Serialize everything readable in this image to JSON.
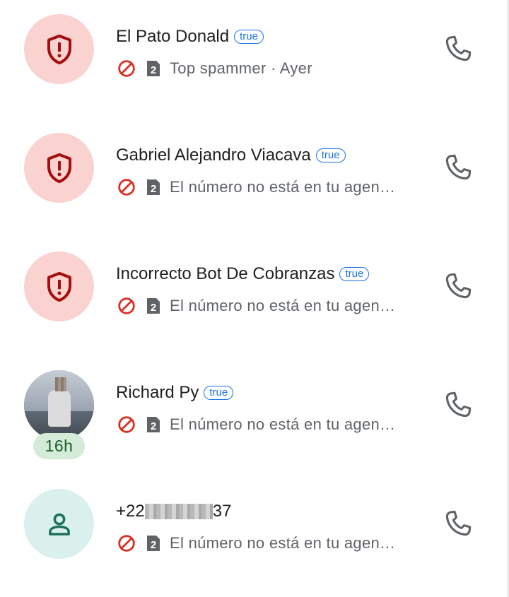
{
  "calls": [
    {
      "name": "El Pato Donald",
      "tag": "true",
      "detail": "Top spammer · Ayer",
      "sim": "2",
      "avatar": "spam-shield-icon"
    },
    {
      "name": "Gabriel Alejandro Viacava",
      "tag": "true",
      "detail": "El número no está en tu agen…",
      "sim": "2",
      "avatar": "spam-shield-icon"
    },
    {
      "name": "Incorrecto Bot De Cobranzas",
      "tag": "true",
      "detail": "El número no está en tu agen…",
      "sim": "2",
      "avatar": "spam-shield-icon"
    },
    {
      "name": "Richard Py",
      "tag": "true",
      "detail": "El número no está en tu agen…",
      "sim": "2",
      "avatar": "photo",
      "badge": "16h"
    },
    {
      "name_prefix": "+22",
      "name_suffix": "37",
      "detail": "El número no está en tu agen…",
      "sim": "2",
      "avatar": "person-icon"
    }
  ],
  "colors": {
    "spam_bg": "#fad2cf",
    "spam_icon": "#a50e0e",
    "blocked_icon": "#d93025",
    "tag": "#1a73e8",
    "contact_bg": "#d9f0ec",
    "contact_icon": "#1e6f5c",
    "badge_bg": "#d4ecd7"
  }
}
